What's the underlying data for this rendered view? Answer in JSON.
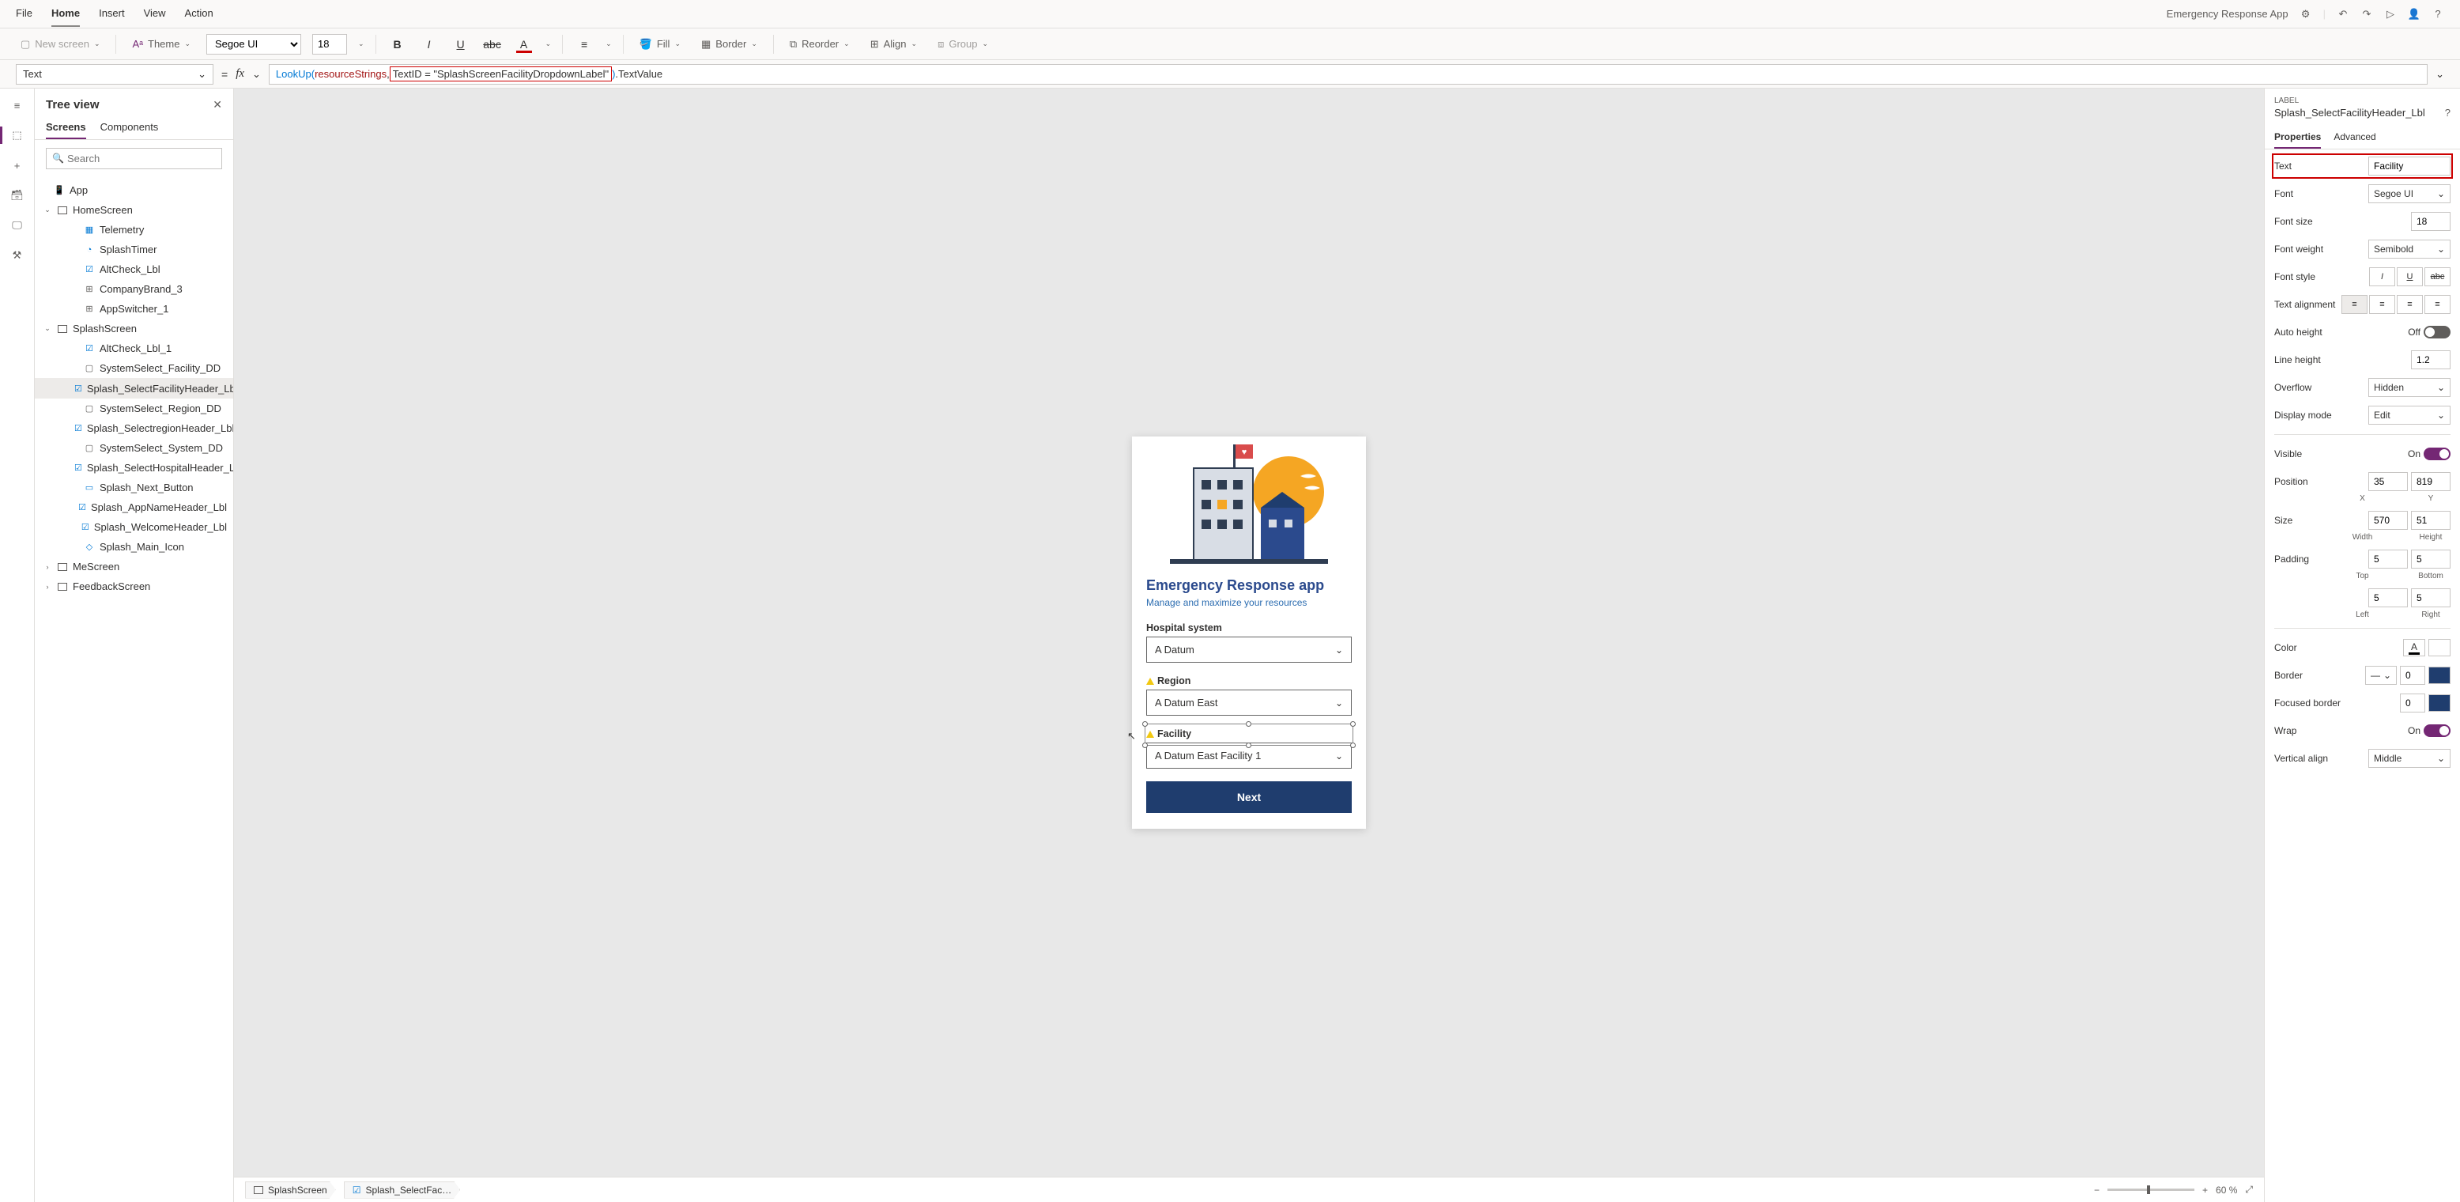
{
  "appName": "Emergency Response App",
  "menubar": [
    "File",
    "Home",
    "Insert",
    "View",
    "Action"
  ],
  "menubarActive": 1,
  "toolbar": {
    "newScreen": "New screen",
    "theme": "Theme",
    "font": "Segoe UI",
    "size": "18",
    "fill": "Fill",
    "border": "Border",
    "reorder": "Reorder",
    "align": "Align",
    "group": "Group"
  },
  "formula": {
    "property": "Text",
    "parts": {
      "p1": "LookUp(",
      "p2": "resourceStrings",
      "p3": ", ",
      "p4": "TextID = \"SplashScreenFacilityDropdownLabel\"",
      "p5": ")",
      "p6": ".TextValue"
    }
  },
  "tree": {
    "title": "Tree view",
    "tabs": [
      "Screens",
      "Components"
    ],
    "activeTab": 0,
    "searchPlaceholder": "Search",
    "app": "App",
    "items": [
      {
        "label": "HomeScreen",
        "type": "screen",
        "level": 1,
        "expanded": true
      },
      {
        "label": "Telemetry",
        "type": "component",
        "level": 2
      },
      {
        "label": "SplashTimer",
        "type": "timer",
        "level": 2
      },
      {
        "label": "AltCheck_Lbl",
        "type": "label",
        "level": 2
      },
      {
        "label": "CompanyBrand_3",
        "type": "group",
        "level": 2
      },
      {
        "label": "AppSwitcher_1",
        "type": "group",
        "level": 2
      },
      {
        "label": "SplashScreen",
        "type": "screen",
        "level": 1,
        "expanded": true
      },
      {
        "label": "AltCheck_Lbl_1",
        "type": "label",
        "level": 2
      },
      {
        "label": "SystemSelect_Facility_DD",
        "type": "control",
        "level": 2
      },
      {
        "label": "Splash_SelectFacilityHeader_Lbl",
        "type": "label",
        "level": 2,
        "selected": true
      },
      {
        "label": "SystemSelect_Region_DD",
        "type": "control",
        "level": 2
      },
      {
        "label": "Splash_SelectregionHeader_Lbl",
        "type": "label",
        "level": 2
      },
      {
        "label": "SystemSelect_System_DD",
        "type": "control",
        "level": 2
      },
      {
        "label": "Splash_SelectHospitalHeader_Lbl",
        "type": "label",
        "level": 2
      },
      {
        "label": "Splash_Next_Button",
        "type": "button",
        "level": 2
      },
      {
        "label": "Splash_AppNameHeader_Lbl",
        "type": "label",
        "level": 2
      },
      {
        "label": "Splash_WelcomeHeader_Lbl",
        "type": "label",
        "level": 2
      },
      {
        "label": "Splash_Main_Icon",
        "type": "icon",
        "level": 2
      },
      {
        "label": "MeScreen",
        "type": "screen",
        "level": 1,
        "expanded": false
      },
      {
        "label": "FeedbackScreen",
        "type": "screen",
        "level": 1,
        "expanded": false
      }
    ]
  },
  "canvas": {
    "appTitle": "Emergency Response app",
    "appSubtitle": "Manage and maximize your resources",
    "labels": {
      "hospital": "Hospital system",
      "region": "Region",
      "facility": "Facility"
    },
    "values": {
      "hospital": "A Datum",
      "region": "A Datum East",
      "facility": "A Datum East Facility 1"
    },
    "next": "Next",
    "breadcrumb1": "SplashScreen",
    "breadcrumb2": "Splash_SelectFac…",
    "zoom": "60 %"
  },
  "props": {
    "type": "LABEL",
    "name": "Splash_SelectFacilityHeader_Lbl",
    "tabs": [
      "Properties",
      "Advanced"
    ],
    "activeTab": 0,
    "rows": {
      "text": {
        "label": "Text",
        "value": "Facility"
      },
      "font": {
        "label": "Font",
        "value": "Segoe UI"
      },
      "fontSize": {
        "label": "Font size",
        "value": "18"
      },
      "fontWeight": {
        "label": "Font weight",
        "value": "Semibold"
      },
      "fontStyle": {
        "label": "Font style"
      },
      "textAlign": {
        "label": "Text alignment"
      },
      "autoHeight": {
        "label": "Auto height",
        "value": "Off"
      },
      "lineHeight": {
        "label": "Line height",
        "value": "1.2"
      },
      "overflow": {
        "label": "Overflow",
        "value": "Hidden"
      },
      "displayMode": {
        "label": "Display mode",
        "value": "Edit"
      },
      "visible": {
        "label": "Visible",
        "value": "On"
      },
      "position": {
        "label": "Position",
        "x": "35",
        "y": "819",
        "xl": "X",
        "yl": "Y"
      },
      "size": {
        "label": "Size",
        "w": "570",
        "h": "51",
        "wl": "Width",
        "hl": "Height"
      },
      "padding": {
        "label": "Padding",
        "t": "5",
        "b": "5",
        "l": "5",
        "r": "5",
        "tl": "Top",
        "bl": "Bottom",
        "ll": "Left",
        "rl": "Right"
      },
      "color": {
        "label": "Color"
      },
      "border": {
        "label": "Border",
        "value": "0"
      },
      "focusedBorder": {
        "label": "Focused border",
        "value": "0"
      },
      "wrap": {
        "label": "Wrap",
        "value": "On"
      },
      "verticalAlign": {
        "label": "Vertical align",
        "value": "Middle"
      }
    }
  }
}
